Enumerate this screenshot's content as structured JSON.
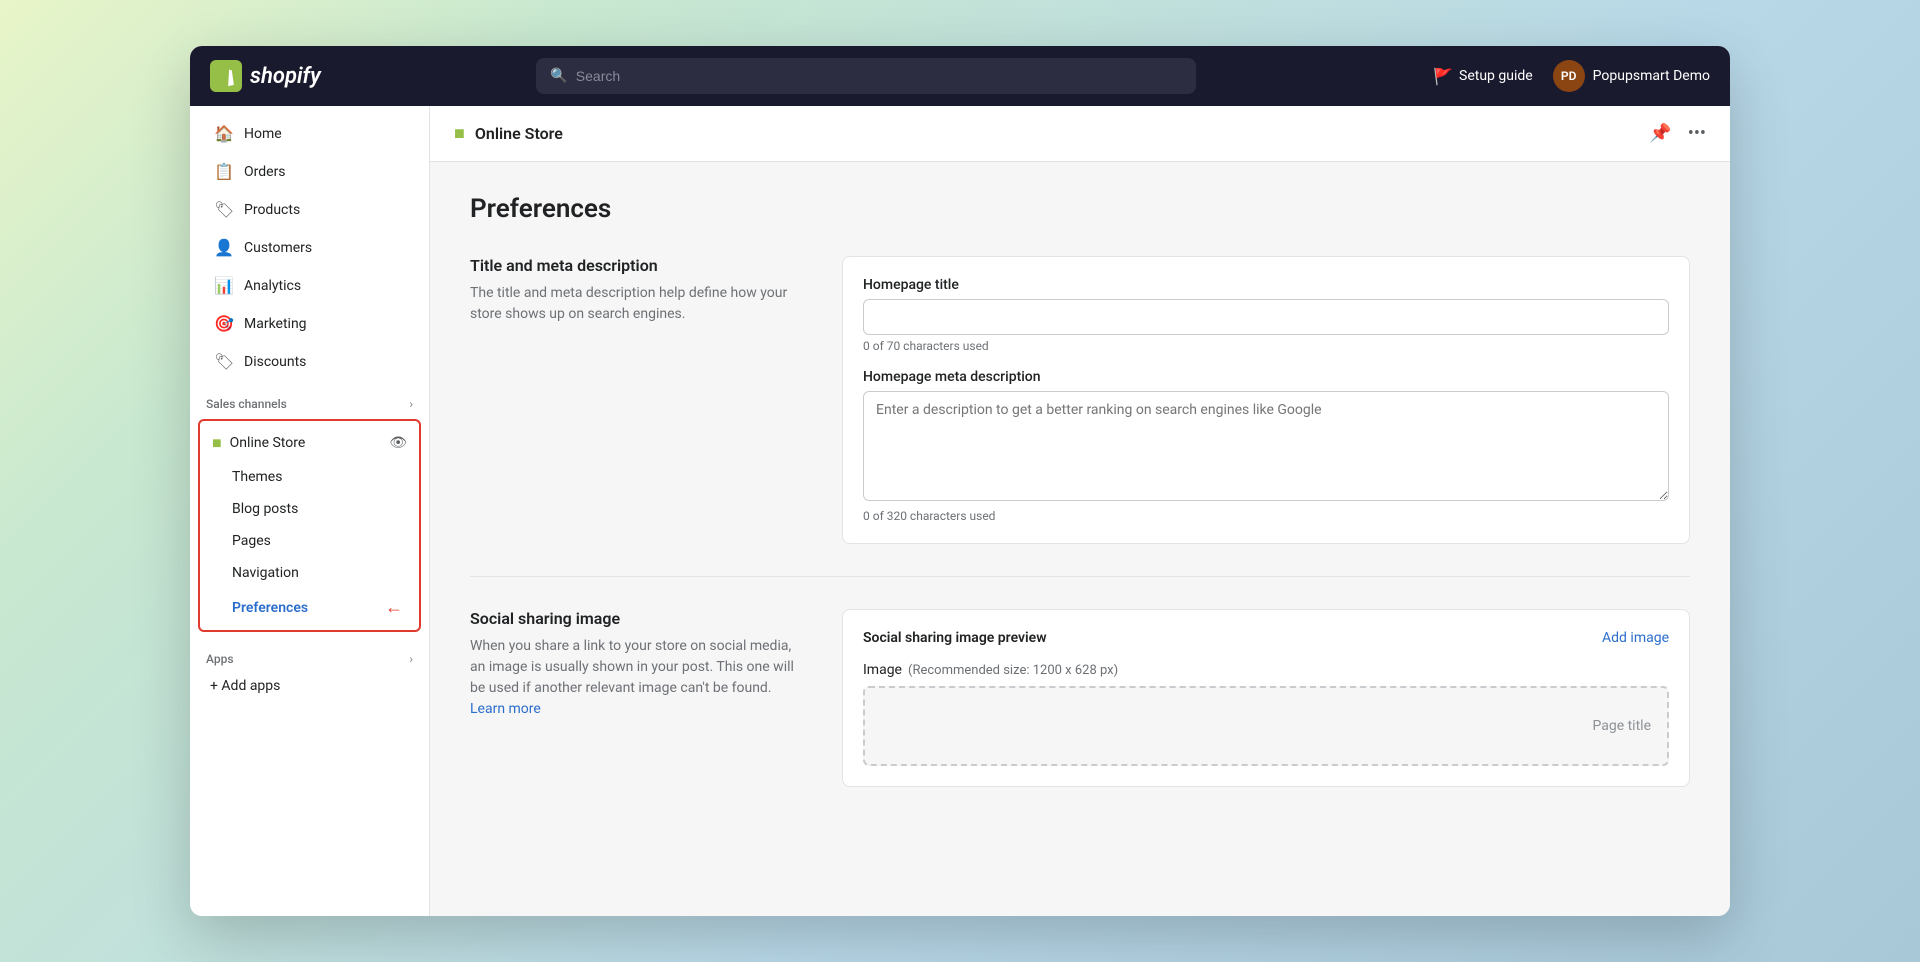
{
  "topbar": {
    "logo_icon": "🛍",
    "logo_text": "shopify",
    "search_placeholder": "Search",
    "setup_guide_label": "Setup guide",
    "user_initials": "PD",
    "user_name": "Popupsmart Demo"
  },
  "sidebar": {
    "nav_items": [
      {
        "id": "home",
        "label": "Home",
        "icon": "🏠"
      },
      {
        "id": "orders",
        "label": "Orders",
        "icon": "📋"
      },
      {
        "id": "products",
        "label": "Products",
        "icon": "🏷"
      },
      {
        "id": "customers",
        "label": "Customers",
        "icon": "👤"
      },
      {
        "id": "analytics",
        "label": "Analytics",
        "icon": "📊"
      },
      {
        "id": "marketing",
        "label": "Marketing",
        "icon": "🎯"
      },
      {
        "id": "discounts",
        "label": "Discounts",
        "icon": "🏷"
      }
    ],
    "sales_channels_label": "Sales channels",
    "online_store_label": "Online Store",
    "sub_items": [
      {
        "id": "themes",
        "label": "Themes"
      },
      {
        "id": "blog-posts",
        "label": "Blog posts"
      },
      {
        "id": "pages",
        "label": "Pages"
      },
      {
        "id": "navigation",
        "label": "Navigation"
      },
      {
        "id": "preferences",
        "label": "Preferences",
        "active": true
      }
    ],
    "apps_label": "Apps",
    "add_apps_label": "+ Add apps"
  },
  "content_header": {
    "title": "Online Store",
    "pin_icon": "📌",
    "more_icon": "···"
  },
  "page": {
    "title": "Preferences",
    "title_meta_section": {
      "heading": "Title and meta description",
      "description": "The title and meta description help define how your store shows up on search engines.",
      "homepage_title_label": "Homepage title",
      "homepage_title_placeholder": "",
      "homepage_title_char_count": "0 of 70 characters used",
      "meta_desc_label": "Homepage meta description",
      "meta_desc_placeholder": "Enter a description to get a better ranking on search engines like Google",
      "meta_desc_char_count": "0 of 320 characters used"
    },
    "social_section": {
      "left_heading": "Social sharing image",
      "left_description": "When you share a link to your store on social media, an image is usually shown in your post. This one will be used if another relevant image can't be found.",
      "learn_more_label": "Learn more",
      "card_title": "Social sharing image preview",
      "add_image_label": "Add image",
      "image_label": "Image",
      "image_size_hint": "(Recommended size: 1200 x 628 px)",
      "page_title_placeholder": "Page title"
    }
  }
}
